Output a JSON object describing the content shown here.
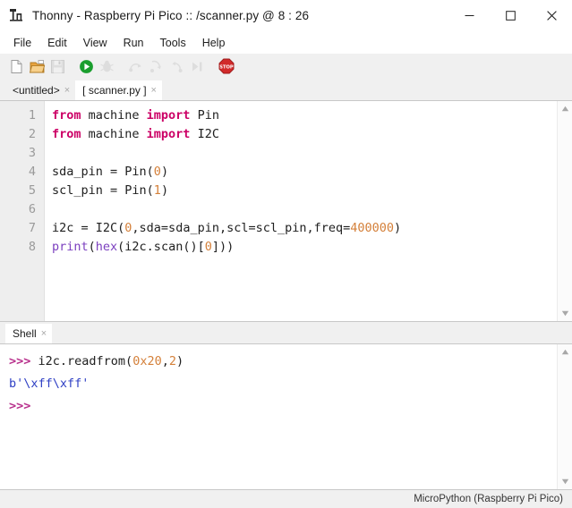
{
  "window": {
    "title": "Thonny  -  Raspberry Pi Pico :: /scanner.py  @  8 : 26",
    "app_icon": "thonny-logo-icon",
    "controls": {
      "minimize": "–",
      "maximize": "□",
      "close": "✕"
    }
  },
  "menubar": {
    "items": [
      {
        "label": "File"
      },
      {
        "label": "Edit"
      },
      {
        "label": "View"
      },
      {
        "label": "Run"
      },
      {
        "label": "Tools"
      },
      {
        "label": "Help"
      }
    ]
  },
  "toolbar": {
    "buttons": [
      {
        "name": "new-file-icon",
        "enabled": true
      },
      {
        "name": "open-file-icon",
        "enabled": true
      },
      {
        "name": "save-file-icon",
        "enabled": false
      },
      {
        "name": "run-icon",
        "enabled": true
      },
      {
        "name": "debug-icon",
        "enabled": false
      },
      {
        "name": "step-over-icon",
        "enabled": false
      },
      {
        "name": "step-into-icon",
        "enabled": false
      },
      {
        "name": "step-out-icon",
        "enabled": false
      },
      {
        "name": "resume-icon",
        "enabled": false
      },
      {
        "name": "stop-icon",
        "enabled": true
      }
    ]
  },
  "editor": {
    "tabs": [
      {
        "label": "<untitled>",
        "active": false,
        "close": "×"
      },
      {
        "label": "[ scanner.py ]",
        "active": true,
        "close": "×"
      }
    ],
    "line_numbers": [
      "1",
      "2",
      "3",
      "4",
      "5",
      "6",
      "7",
      "8"
    ],
    "lines": [
      [
        {
          "t": "from",
          "c": "kw"
        },
        {
          "t": " machine ",
          "c": "plain"
        },
        {
          "t": "import",
          "c": "kw"
        },
        {
          "t": " Pin",
          "c": "plain"
        }
      ],
      [
        {
          "t": "from",
          "c": "kw"
        },
        {
          "t": " machine ",
          "c": "plain"
        },
        {
          "t": "import",
          "c": "kw"
        },
        {
          "t": " I2C",
          "c": "plain"
        }
      ],
      [],
      [
        {
          "t": "sda_pin = Pin(",
          "c": "plain"
        },
        {
          "t": "0",
          "c": "num"
        },
        {
          "t": ")",
          "c": "plain"
        }
      ],
      [
        {
          "t": "scl_pin = Pin(",
          "c": "plain"
        },
        {
          "t": "1",
          "c": "num"
        },
        {
          "t": ")",
          "c": "plain"
        }
      ],
      [],
      [
        {
          "t": "i2c = I2C(",
          "c": "plain"
        },
        {
          "t": "0",
          "c": "num"
        },
        {
          "t": ",sda=sda_pin,scl=scl_pin,freq=",
          "c": "plain"
        },
        {
          "t": "400000",
          "c": "num"
        },
        {
          "t": ")",
          "c": "plain"
        }
      ],
      [
        {
          "t": "print",
          "c": "bif"
        },
        {
          "t": "(",
          "c": "plain"
        },
        {
          "t": "hex",
          "c": "bif"
        },
        {
          "t": "(i2c.scan()[",
          "c": "plain"
        },
        {
          "t": "0",
          "c": "num"
        },
        {
          "t": "]))",
          "c": "plain"
        }
      ]
    ],
    "scrollbar": {
      "up": "▲",
      "down": "▼"
    }
  },
  "shell": {
    "tabs": [
      {
        "label": "Shell",
        "active": true,
        "close": "×"
      }
    ],
    "lines": [
      [
        {
          "t": ">>> ",
          "c": "prompt"
        },
        {
          "t": "i2c.readfrom(",
          "c": "plain"
        },
        {
          "t": "0x20",
          "c": "num"
        },
        {
          "t": ",",
          "c": "plain"
        },
        {
          "t": "2",
          "c": "num"
        },
        {
          "t": ")",
          "c": "plain"
        }
      ],
      [
        {
          "t": "b'\\xff\\xff'",
          "c": "out"
        }
      ],
      [
        {
          "t": ">>>",
          "c": "prompt"
        }
      ]
    ],
    "scrollbar": {
      "up": "▲",
      "down": "▼"
    }
  },
  "statusbar": {
    "interpreter": "MicroPython (Raspberry Pi Pico)"
  },
  "colors": {
    "keyword": "#cc0066",
    "number": "#d4803a",
    "builtin": "#7b3fbf",
    "prompt": "#b8308c",
    "output": "#2e3fc4",
    "run_green": "#1a9e2e",
    "stop_red": "#d12a2a",
    "gutter_bg": "#eeeeee",
    "chrome_bg": "#f0f0f0"
  }
}
